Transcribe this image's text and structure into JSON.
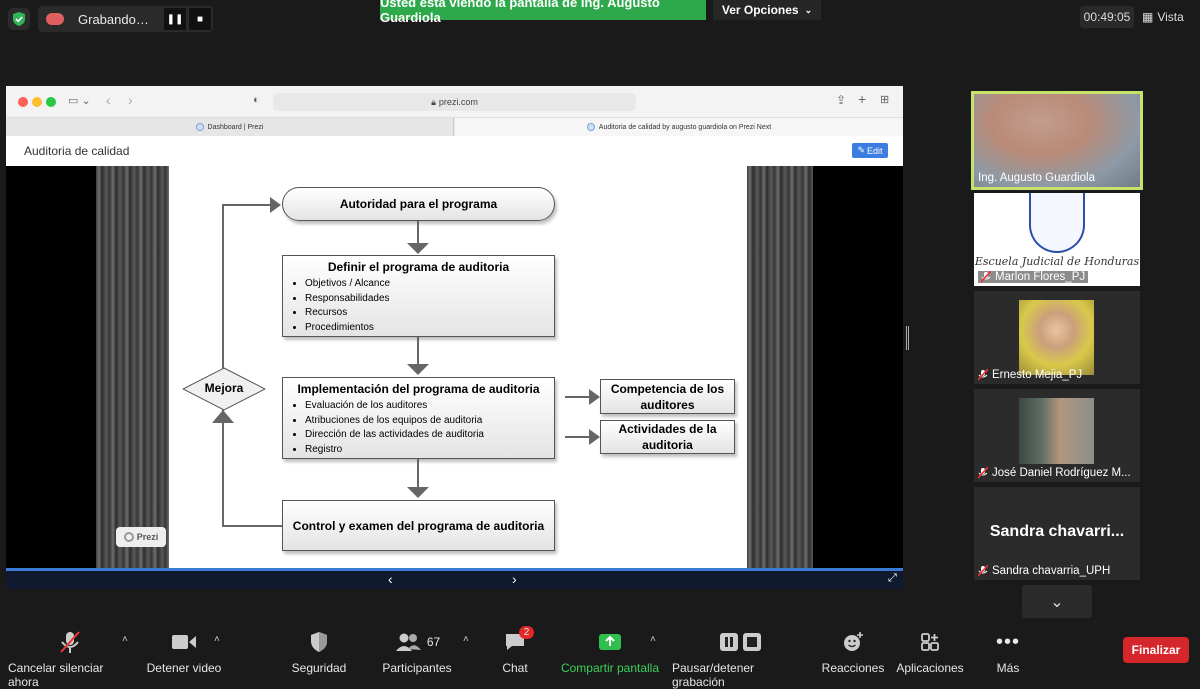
{
  "topbar": {
    "recording_label": "Grabando…",
    "share_banner": "Usted está viendo la pantalla de Ing. Augusto Guardiola",
    "view_options": "Ver Opciones",
    "timer": "00:49:05",
    "view_label": "Vista"
  },
  "browser": {
    "url": "prezi.com",
    "tab1": "Dashboard | Prezi",
    "tab2": "Auditoria de calidad by augusto guardiola on Prezi Next",
    "prezi_title": "Auditoria de calidad",
    "edit_label": "Edit",
    "prezi_badge": "Prezi"
  },
  "diagram": {
    "box1": "Autoridad para el programa",
    "box2_title": "Definir el programa de auditoria",
    "box2_items": [
      "Objetivos / Alcance",
      "Responsabilidades",
      "Recursos",
      "Procedimientos"
    ],
    "box3_title": "Implementación del programa de auditoria",
    "box3_items": [
      "Evaluación de los auditores",
      "Atribuciones de los equipos de auditoria",
      "Dirección de las actividades de auditoria",
      "Registro"
    ],
    "box4": "Control y examen del programa de auditoria",
    "side1": "Competencia de los auditores",
    "side2": "Actividades de la auditoria",
    "diamond": "Mejora"
  },
  "participants": [
    {
      "name": "Ing. Augusto Guardiola",
      "muted": false
    },
    {
      "name": "Marlon Flores_PJ",
      "muted": true,
      "logo_text": "Escuela Judicial de Honduras"
    },
    {
      "name": "Ernesto Mejia_PJ",
      "muted": true
    },
    {
      "name": "José Daniel Rodríguez M...",
      "muted": true
    },
    {
      "name": "Sandra chavarria_UPH",
      "muted": true,
      "display": "Sandra chavarri..."
    }
  ],
  "toolbar": {
    "mute": "Cancelar silenciar ahora",
    "video": "Detener video",
    "security": "Seguridad",
    "participants": "Participantes",
    "participants_count": "67",
    "chat": "Chat",
    "chat_badge": "2",
    "share": "Compartir pantalla",
    "record": "Pausar/detener grabación",
    "reactions": "Reacciones",
    "apps": "Aplicaciones",
    "more": "Más",
    "end": "Finalizar"
  },
  "colors": {
    "share_green": "#2da84a",
    "active_speaker": "#c6e26b",
    "end_red": "#d5262c",
    "edit_blue": "#3b7de0"
  }
}
